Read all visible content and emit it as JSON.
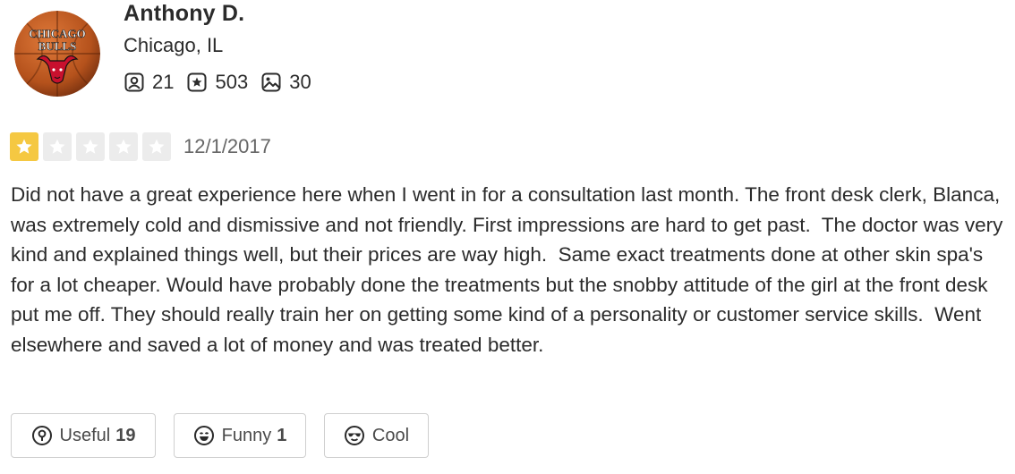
{
  "user": {
    "name": "Anthony D.",
    "location": "Chicago, IL",
    "avatar_text_top": "CHICAGO",
    "avatar_text_bottom": "BULLS",
    "friends_count": "21",
    "reviews_count": "503",
    "photos_count": "30"
  },
  "review": {
    "rating": 1,
    "max_rating": 5,
    "date": "12/1/2017",
    "text": "Did not have a great experience here when I went in for a consultation last month. The front desk clerk, Blanca, was extremely cold and dismissive and not friendly. First impressions are hard to get past.  The doctor was very kind and explained things well, but their prices are way high.  Same exact treatments done at other skin spa's for a lot cheaper. Would have probably done the treatments but the snobby attitude of the girl at the front desk put me off. They should really train her on getting some kind of a personality or customer service skills.  Went elsewhere and saved a lot of money and was treated better."
  },
  "actions": {
    "useful_label": "Useful",
    "useful_count": "19",
    "funny_label": "Funny",
    "funny_count": "1",
    "cool_label": "Cool"
  },
  "icons": {
    "friends": "friends-icon",
    "reviews": "review-star-icon",
    "photos": "photo-icon",
    "useful": "useful-lightbulb-icon",
    "funny": "funny-face-icon",
    "cool": "cool-sunglasses-icon"
  },
  "colors": {
    "star_filled": "#f5c842",
    "star_empty": "#ececec",
    "text": "#2b2b2b",
    "date": "#666666",
    "button_border": "#cfcfcf"
  }
}
